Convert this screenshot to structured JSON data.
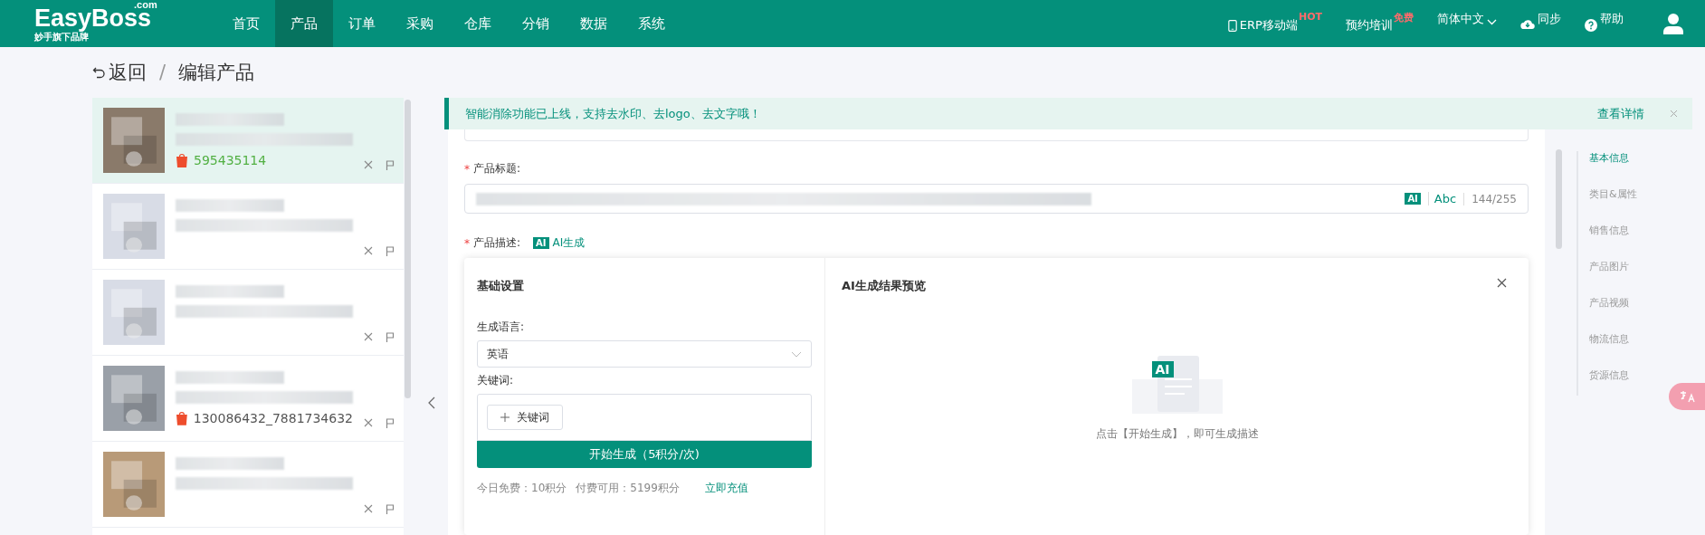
{
  "topbar": {
    "logo": "EasyBoss",
    "logo_suffix": ".com",
    "logo_tagline": "妙手旗下品牌",
    "nav": [
      {
        "label": "首页",
        "selected": false
      },
      {
        "label": "产品",
        "selected": true
      },
      {
        "label": "订单",
        "selected": false
      },
      {
        "label": "采购",
        "selected": false
      },
      {
        "label": "仓库",
        "selected": false
      },
      {
        "label": "分销",
        "selected": false
      },
      {
        "label": "数据",
        "selected": false
      },
      {
        "label": "系统",
        "selected": false
      }
    ],
    "right": [
      {
        "kind": "mobile",
        "label": "ERP移动端",
        "badge": "HOT"
      },
      {
        "kind": "plain",
        "label": "预约培训",
        "badge": "免费"
      },
      {
        "kind": "lang",
        "label": "简体中文"
      },
      {
        "kind": "sync",
        "label": "同步"
      },
      {
        "kind": "help",
        "label": "帮助"
      },
      {
        "kind": "user"
      }
    ]
  },
  "breadcrumb": {
    "back": "返回",
    "separator": "/",
    "current": "编辑产品"
  },
  "products": [
    {
      "selected": true,
      "sku": "595435114",
      "shop": true
    },
    {
      "selected": false,
      "shop": false
    },
    {
      "selected": false,
      "shop": false
    },
    {
      "selected": false,
      "sku": "130086432_7881734632",
      "shop": true
    },
    {
      "selected": false,
      "shop": false
    }
  ],
  "notice": {
    "text": "智能消除功能已上线，支持去水印、去logo、去文字哦！",
    "link": "查看详情"
  },
  "form": {
    "title_required": "*",
    "title_label": "产品标题:",
    "title_ai_badge": "AI",
    "abc": "Abc",
    "title_counter": "144/255",
    "desc_required": "*",
    "desc_label": "产品描述:",
    "desc_ai_badge": "AI",
    "ai_generate": "AI生成"
  },
  "ai_panel": {
    "settings_title": "基础设置",
    "language_label": "生成语言:",
    "language_value": "英语",
    "keywords_label": "关键词:",
    "add_keyword": "关键词",
    "generate_button": "开始生成（5积分/次)",
    "free_today": "今日免费：10积分",
    "paid": "付费可用：5199积分",
    "recharge": "立即充值",
    "preview_title": "AI生成结果预览",
    "empty_hint": "点击【开始生成】，即可生成描述",
    "empty_ai": "AI"
  },
  "anchors": [
    {
      "label": "基本信息",
      "selected": true
    },
    {
      "label": "类目&属性",
      "selected": false
    },
    {
      "label": "销售信息",
      "selected": false
    },
    {
      "label": "产品图片",
      "selected": false
    },
    {
      "label": "产品视频",
      "selected": false
    },
    {
      "label": "物流信息",
      "selected": false
    },
    {
      "label": "货源信息",
      "selected": false
    }
  ]
}
